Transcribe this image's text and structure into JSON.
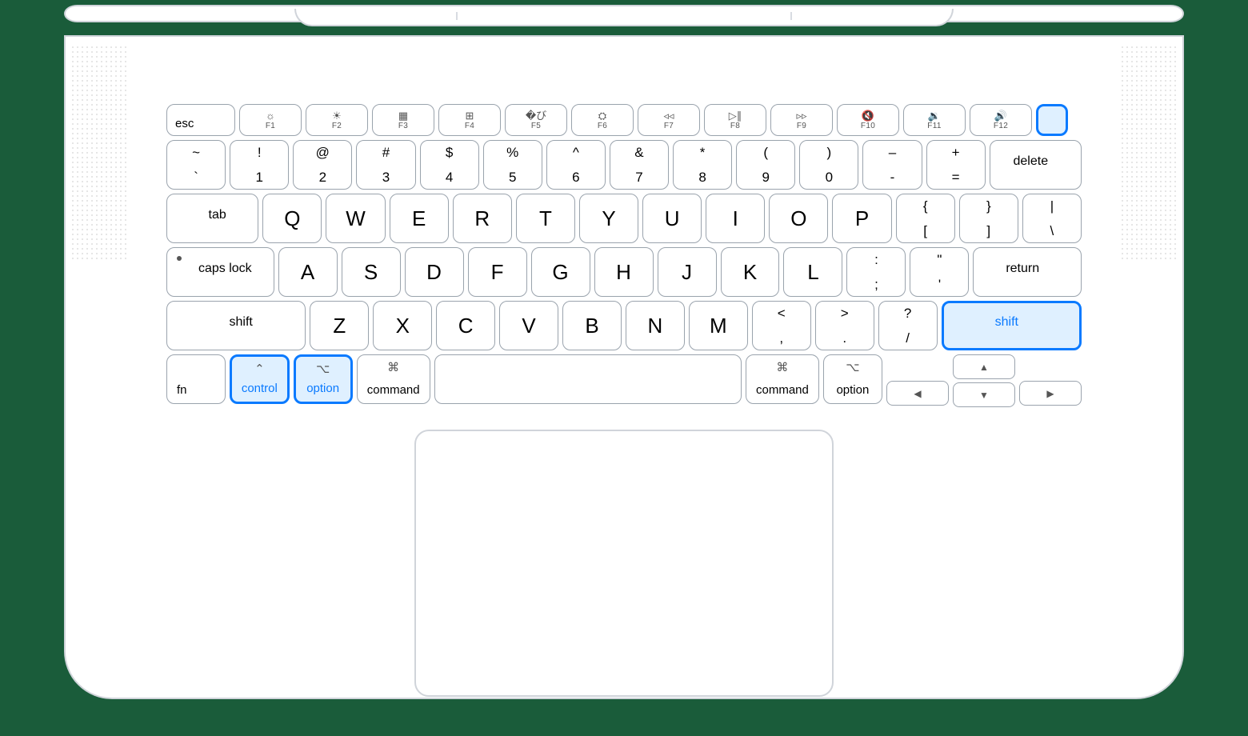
{
  "fnrow": {
    "esc": "esc",
    "keys": [
      {
        "icon": "☼",
        "label": "F1"
      },
      {
        "icon": "☀",
        "label": "F2"
      },
      {
        "icon": "▦",
        "label": "F3"
      },
      {
        "icon": "⊞",
        "label": "F4"
      },
      {
        "icon": "�び",
        "label": "F5"
      },
      {
        "icon": "⛭",
        "label": "F6"
      },
      {
        "icon": "◃◃",
        "label": "F7"
      },
      {
        "icon": "▷∥",
        "label": "F8"
      },
      {
        "icon": "▹▹",
        "label": "F9"
      },
      {
        "icon": "🔇",
        "label": "F10"
      },
      {
        "icon": "🔉",
        "label": "F11"
      },
      {
        "icon": "🔊",
        "label": "F12"
      }
    ]
  },
  "row1": {
    "keys": [
      {
        "u": "~",
        "l": "`"
      },
      {
        "u": "!",
        "l": "1"
      },
      {
        "u": "@",
        "l": "2"
      },
      {
        "u": "#",
        "l": "3"
      },
      {
        "u": "$",
        "l": "4"
      },
      {
        "u": "%",
        "l": "5"
      },
      {
        "u": "^",
        "l": "6"
      },
      {
        "u": "&",
        "l": "7"
      },
      {
        "u": "*",
        "l": "8"
      },
      {
        "u": "(",
        "l": "9"
      },
      {
        "u": ")",
        "l": "0"
      },
      {
        "u": "–",
        "l": "-"
      },
      {
        "u": "+",
        "l": "="
      }
    ],
    "delete": "delete"
  },
  "row2": {
    "tab": "tab",
    "letters": [
      "Q",
      "W",
      "E",
      "R",
      "T",
      "Y",
      "U",
      "I",
      "O",
      "P"
    ],
    "brackets": [
      {
        "u": "{",
        "l": "["
      },
      {
        "u": "}",
        "l": "]"
      },
      {
        "u": "|",
        "l": "\\"
      }
    ]
  },
  "row3": {
    "caps": "caps lock",
    "letters": [
      "A",
      "S",
      "D",
      "F",
      "G",
      "H",
      "J",
      "K",
      "L"
    ],
    "punct": [
      {
        "u": ":",
        "l": ";"
      },
      {
        "u": "\"",
        "l": "'"
      }
    ],
    "return": "return"
  },
  "row4": {
    "shiftL": "shift",
    "letters": [
      "Z",
      "X",
      "C",
      "V",
      "B",
      "N",
      "M"
    ],
    "punct": [
      {
        "u": "<",
        "l": ","
      },
      {
        "u": ">",
        "l": "."
      },
      {
        "u": "?",
        "l": "/"
      }
    ],
    "shiftR": "shift"
  },
  "row5": {
    "fn": "fn",
    "controlIcon": "⌃",
    "control": "control",
    "optionIcon": "⌥",
    "option": "option",
    "commandIcon": "⌘",
    "command": "command",
    "arrows": {
      "up": "▲",
      "down": "▼",
      "left": "◀",
      "right": "▶"
    }
  },
  "highlighted": [
    "touchid",
    "shift-right",
    "control-left",
    "option-left"
  ]
}
